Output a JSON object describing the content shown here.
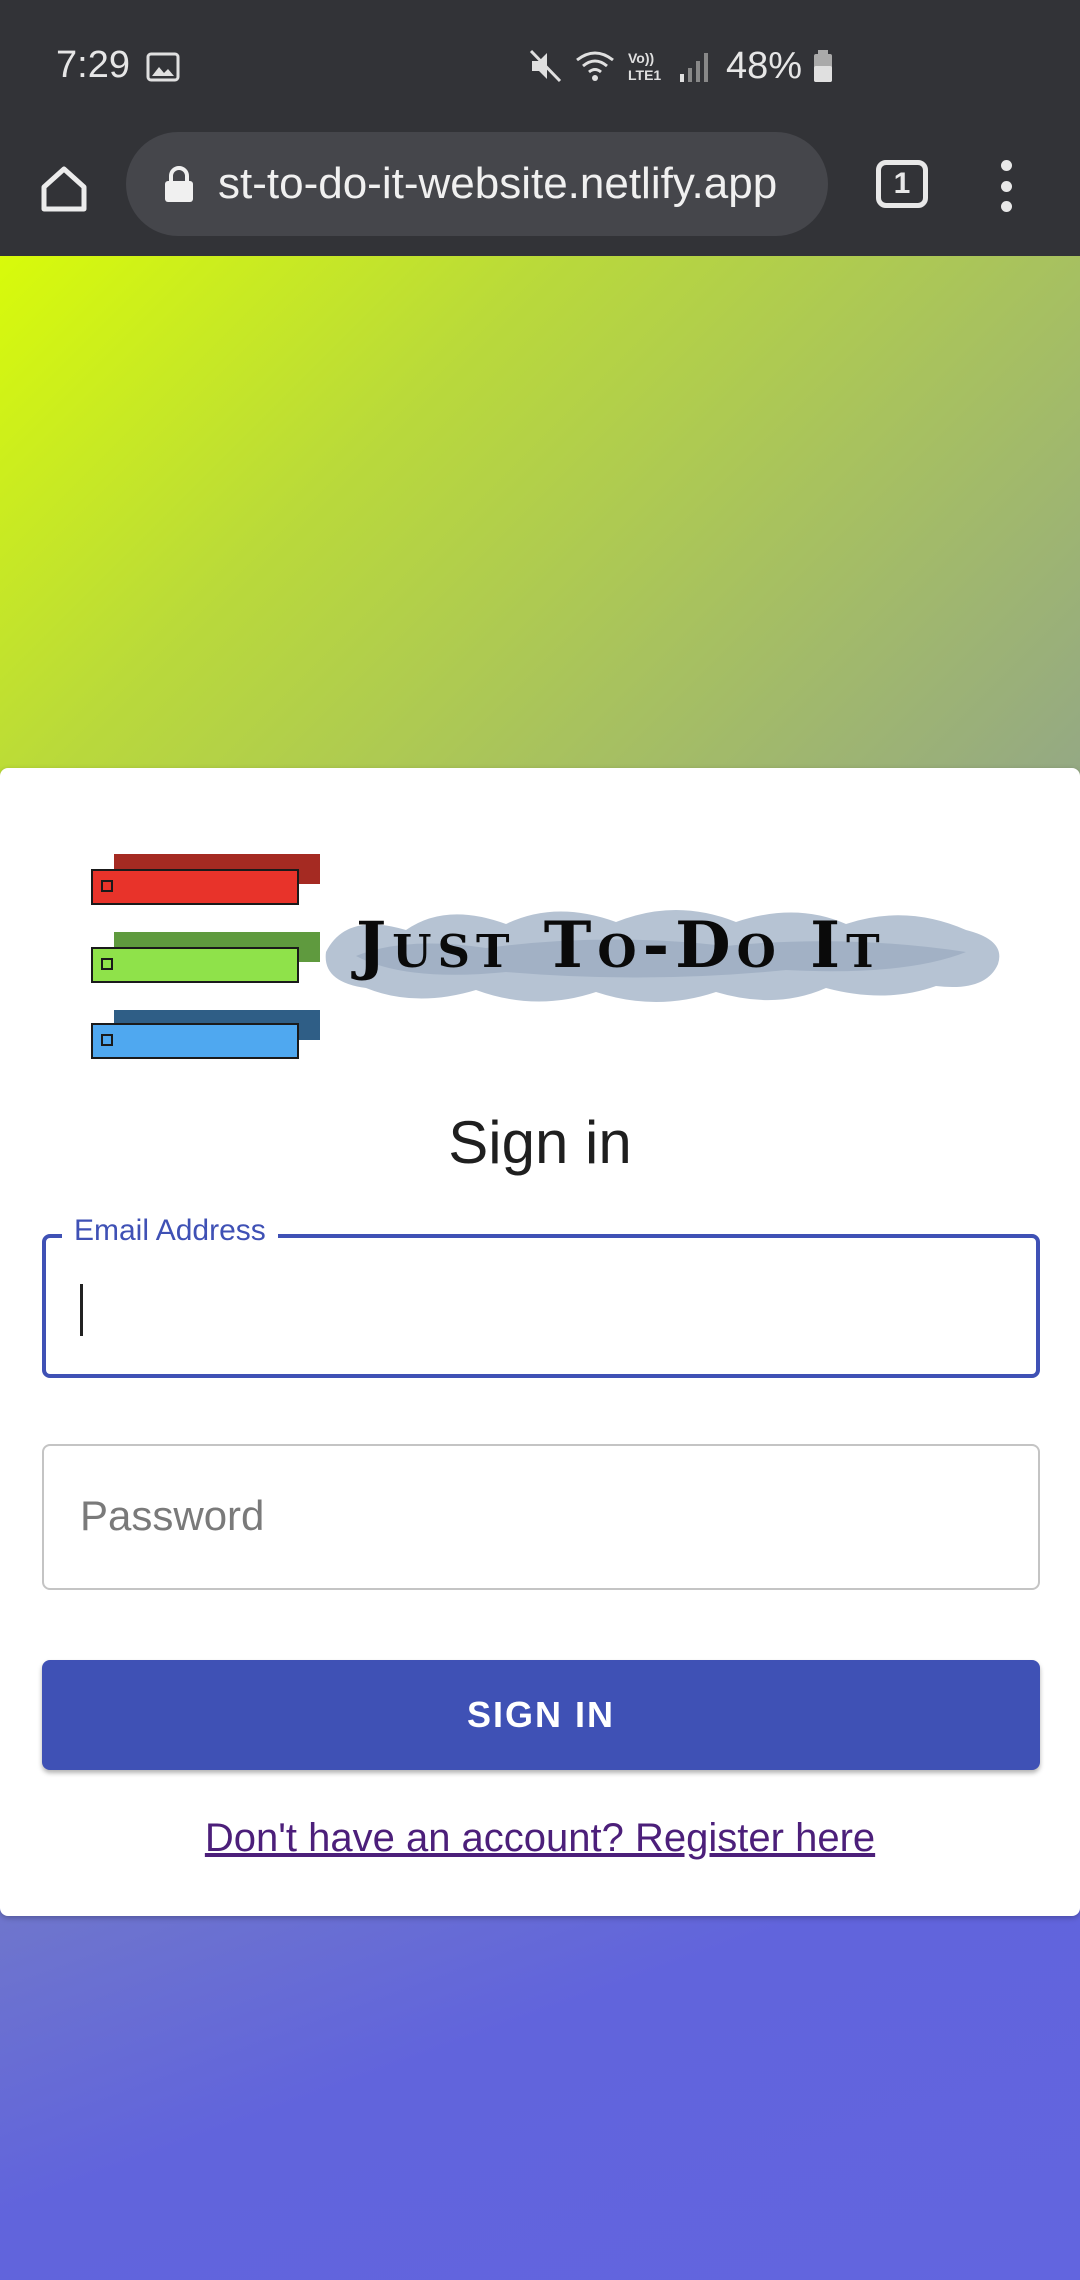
{
  "status_bar": {
    "time": "7:29",
    "battery": "48%",
    "icons": [
      "gallery-icon",
      "mute-icon",
      "wifi-icon",
      "volte-icon",
      "signal-icon",
      "battery-icon"
    ]
  },
  "browser": {
    "url": "st-to-do-it-website.netlify.app",
    "tab_count": "1"
  },
  "logo": {
    "text": "Just To-Do It"
  },
  "form": {
    "title": "Sign in",
    "email_label": "Email Address",
    "email_value": "",
    "password_placeholder": "Password",
    "submit_label": "SIGN IN",
    "register_link": "Don't have an account? Register here"
  },
  "colors": {
    "primary": "#3f51b5",
    "link": "#4c1f7a",
    "toolbar": "#323337",
    "gradient_top": "#d8fb0a",
    "gradient_bottom": "#6265df"
  }
}
